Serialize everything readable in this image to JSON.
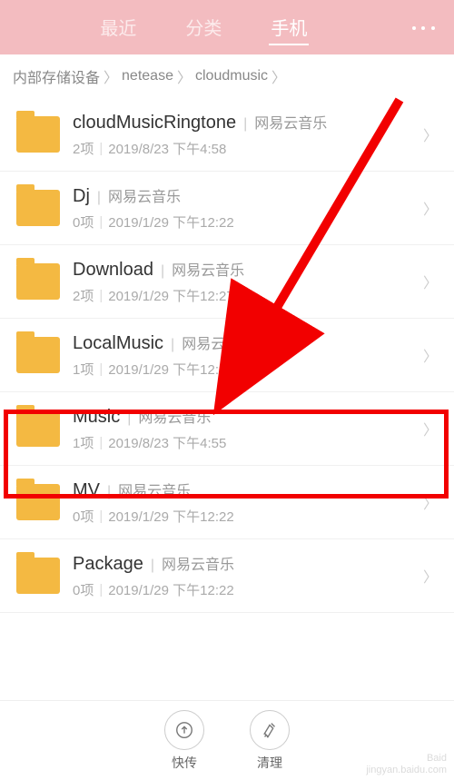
{
  "header": {
    "tabs": [
      "最近",
      "分类",
      "手机"
    ],
    "active_index": 2
  },
  "breadcrumb": [
    "内部存储设备",
    "netease",
    "cloudmusic"
  ],
  "folders": [
    {
      "name": "cloudMusicRingtone",
      "tag": "网易云音乐",
      "count": "2项",
      "time": "2019/8/23 下午4:58"
    },
    {
      "name": "Dj",
      "tag": "网易云音乐",
      "count": "0项",
      "time": "2019/1/29 下午12:22"
    },
    {
      "name": "Download",
      "tag": "网易云音乐",
      "count": "2项",
      "time": "2019/1/29 下午12:27"
    },
    {
      "name": "LocalMusic",
      "tag": "网易云音乐",
      "count": "1项",
      "time": "2019/1/29 下午12:22"
    },
    {
      "name": "Music",
      "tag": "网易云音乐",
      "count": "1项",
      "time": "2019/8/23 下午4:55"
    },
    {
      "name": "MV",
      "tag": "网易云音乐",
      "count": "0项",
      "time": "2019/1/29 下午12:22"
    },
    {
      "name": "Package",
      "tag": "网易云音乐",
      "count": "0项",
      "time": "2019/1/29 下午12:22"
    }
  ],
  "highlighted_folder_index": 4,
  "bottom": {
    "transfer": "快传",
    "clean": "清理"
  },
  "watermark": {
    "line1": "Baid",
    "line2": "jingyan.baidu.com"
  }
}
